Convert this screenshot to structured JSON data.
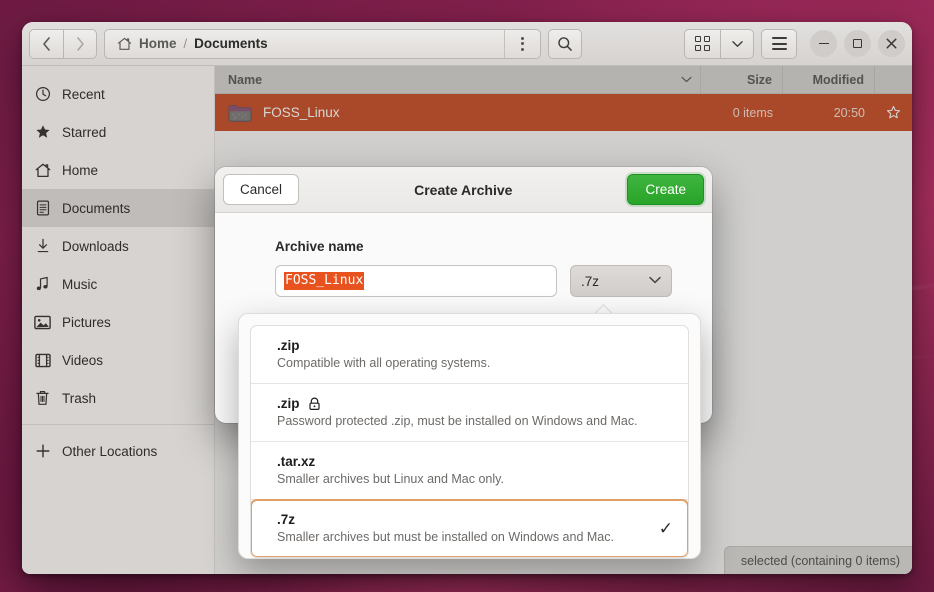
{
  "window": {
    "nav": {
      "back_label": "‹",
      "forward_label": "›"
    },
    "breadcrumbs": [
      {
        "label": "Home",
        "icon": "home-icon",
        "active": false
      },
      {
        "label": "Documents",
        "icon": "",
        "active": true
      }
    ],
    "separator": "/",
    "icons": {
      "path_menu": "three-dots-vertical-icon",
      "search": "search-icon",
      "grid_view": "grid-view-icon",
      "view_dropdown": "chevron-down-icon",
      "hamburger": "hamburger-menu-icon",
      "minimize": "minimize-icon",
      "maximize": "maximize-icon",
      "close": "close-icon"
    }
  },
  "sidebar": {
    "items": [
      {
        "label": "Recent",
        "icon": "clock-icon",
        "selected": false
      },
      {
        "label": "Starred",
        "icon": "star-icon",
        "selected": false
      },
      {
        "label": "Home",
        "icon": "home-icon",
        "selected": false
      },
      {
        "label": "Documents",
        "icon": "document-icon",
        "selected": true
      },
      {
        "label": "Downloads",
        "icon": "download-icon",
        "selected": false
      },
      {
        "label": "Music",
        "icon": "music-icon",
        "selected": false
      },
      {
        "label": "Pictures",
        "icon": "image-icon",
        "selected": false
      },
      {
        "label": "Videos",
        "icon": "film-icon",
        "selected": false
      },
      {
        "label": "Trash",
        "icon": "trash-icon",
        "selected": false
      }
    ],
    "other_locations": {
      "label": "Other Locations",
      "icon": "plus-icon"
    }
  },
  "file_list": {
    "columns": {
      "name": "Name",
      "size": "Size",
      "modified": "Modified",
      "sort_icon": "chevron-down-icon"
    },
    "rows": [
      {
        "name": "FOSS_Linux",
        "size": "0 items",
        "modified": "20:50",
        "icon": "folder-icon",
        "star": "star-outline-icon",
        "selected": true
      }
    ],
    "status": "selected  (containing 0 items)"
  },
  "dialog": {
    "title": "Create Archive",
    "cancel_label": "Cancel",
    "create_label": "Create",
    "field_label": "Archive name",
    "name_value": "FOSS_Linux",
    "format_value": ".7z",
    "format_chevron": "chevron-down-icon"
  },
  "dropdown": {
    "options": [
      {
        "title": ".zip",
        "desc": "Compatible with all operating systems.",
        "lock": false,
        "selected": false
      },
      {
        "title": ".zip",
        "desc": "Password protected .zip, must be installed on Windows and Mac.",
        "lock": true,
        "selected": false
      },
      {
        "title": ".tar.xz",
        "desc": "Smaller archives but Linux and Mac only.",
        "lock": false,
        "selected": false
      },
      {
        "title": ".7z",
        "desc": "Smaller archives but must be installed on Windows and Mac.",
        "lock": false,
        "selected": true
      }
    ],
    "check_glyph": "✓",
    "lock_icon": "lock-icon"
  },
  "colors": {
    "selection_orange": "#c0360a",
    "text_select_orange": "#e8521f",
    "create_green": "#28a428",
    "focus_ring": "#e0a06a"
  }
}
